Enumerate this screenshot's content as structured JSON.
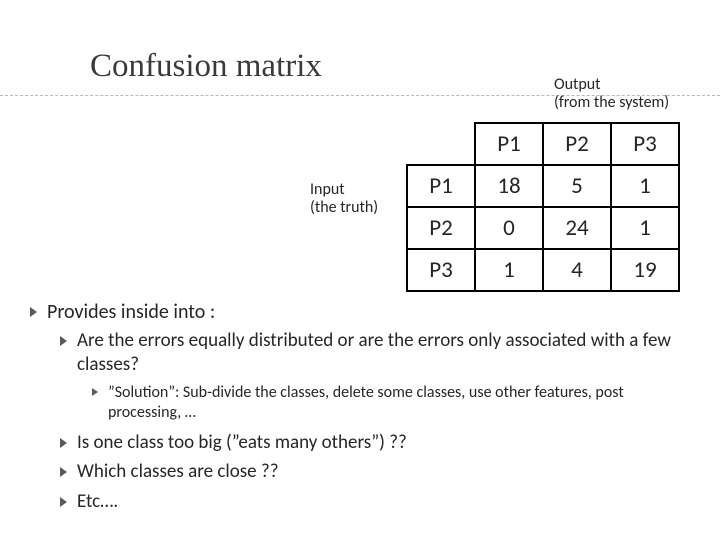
{
  "title": "Confusion matrix",
  "output_label_line1": "Output",
  "output_label_line2": "(from the system)",
  "input_label_line1": "Input",
  "input_label_line2": "(the truth)",
  "matrix": {
    "col_headers": [
      "P1",
      "P2",
      "P3"
    ],
    "row_headers": [
      "P1",
      "P2",
      "P3"
    ],
    "rows": [
      [
        "18",
        "5",
        "1"
      ],
      [
        "0",
        "24",
        "1"
      ],
      [
        "1",
        "4",
        "19"
      ]
    ]
  },
  "bullets": {
    "l1": "Provides inside into :",
    "q1": "Are the errors equally distributed or are the errors only associated with a few classes?",
    "q1_sub": "”Solution”: Sub-divide the classes, delete some classes, use other features, post processing, …",
    "q2": "Is one class too big (”eats many others”) ??",
    "q3": "Which classes are close ??",
    "q4": "Etc…."
  },
  "chart_data": {
    "type": "table",
    "title": "Confusion matrix",
    "col_axis": "Output (from the system)",
    "row_axis": "Input (the truth)",
    "columns": [
      "P1",
      "P2",
      "P3"
    ],
    "rows": [
      "P1",
      "P2",
      "P3"
    ],
    "values": [
      [
        18,
        5,
        1
      ],
      [
        0,
        24,
        1
      ],
      [
        1,
        4,
        19
      ]
    ]
  }
}
